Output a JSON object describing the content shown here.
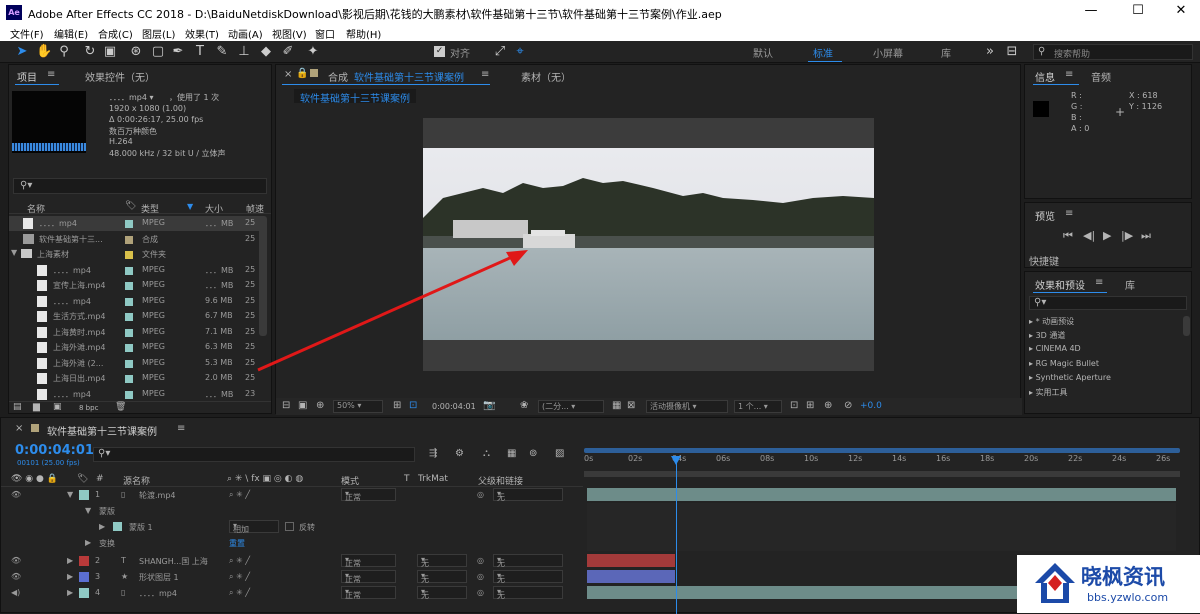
{
  "window": {
    "title": "Adobe After Effects CC 2018 - D:\\BaiduNetdiskDownload\\影视后期\\花钱的大鹏素材\\软件基础第十三节\\软件基础第十三节案例\\作业.aep",
    "logo": "Ae",
    "minimize": "—",
    "maximize": "☐",
    "close": "✕"
  },
  "menu": [
    "文件(F)",
    "编辑(E)",
    "合成(C)",
    "图层(L)",
    "效果(T)",
    "动画(A)",
    "视图(V)",
    "窗口",
    "帮助(H)"
  ],
  "toolbar": {
    "align_label": "对齐",
    "workspaces": [
      "默认",
      "标准",
      "小屏幕",
      "库"
    ],
    "active_workspace": "标准",
    "search_placeholder": "搜索帮助"
  },
  "project": {
    "tab_project": "项目",
    "tab_effects": "效果控件（无）",
    "selected_name": "．．．．mp4 ▾",
    "used": "，使用了 1 次",
    "info": [
      "1920 x 1080 (1.00)",
      "Δ 0:00:26:17, 25.00 fps",
      "数百万种颜色",
      "H.264",
      "48.000 kHz / 32 bit U / 立体声"
    ],
    "columns": {
      "name": "名称",
      "type": "类型",
      "size": "大小",
      "rate": "帧速"
    },
    "items": [
      {
        "name": "．．．．mp4",
        "type": "MPEG",
        "size": "．．．MB",
        "rate": "25",
        "color": "#8fc9c4",
        "icon": "file"
      },
      {
        "name": "软件基础第十三...",
        "type": "合成",
        "size": "",
        "rate": "25",
        "color": "#b0a27a",
        "icon": "comp"
      },
      {
        "name": "上海素材",
        "type": "文件夹",
        "size": "",
        "rate": "",
        "color": "#d9c04a",
        "icon": "folder"
      },
      {
        "name": "．．．．mp4",
        "type": "MPEG",
        "size": "．．．MB",
        "rate": "25",
        "color": "#8fc9c4",
        "icon": "file"
      },
      {
        "name": "宣传上海.mp4",
        "type": "MPEG",
        "size": "．．．MB",
        "rate": "25",
        "color": "#8fc9c4",
        "icon": "file"
      },
      {
        "name": "．．．．mp4",
        "type": "MPEG",
        "size": "9.6 MB",
        "rate": "25",
        "color": "#8fc9c4",
        "icon": "file"
      },
      {
        "name": "生活方式.mp4",
        "type": "MPEG",
        "size": "6.7 MB",
        "rate": "25",
        "color": "#8fc9c4",
        "icon": "file"
      },
      {
        "name": "上海黄时.mp4",
        "type": "MPEG",
        "size": "7.1 MB",
        "rate": "25",
        "color": "#8fc9c4",
        "icon": "file"
      },
      {
        "name": "上海外滩.mp4",
        "type": "MPEG",
        "size": "6.3 MB",
        "rate": "25",
        "color": "#8fc9c4",
        "icon": "file"
      },
      {
        "name": "上海外滩 (2...",
        "type": "MPEG",
        "size": "5.3 MB",
        "rate": "25",
        "color": "#8fc9c4",
        "icon": "file"
      },
      {
        "name": "上海日出.mp4",
        "type": "MPEG",
        "size": "2.0 MB",
        "rate": "25",
        "color": "#8fc9c4",
        "icon": "file"
      },
      {
        "name": "．．．．mp4",
        "type": "MPEG",
        "size": "．．．MB",
        "rate": "23",
        "color": "#8fc9c4",
        "icon": "file"
      }
    ],
    "bpc": "8 bpc"
  },
  "comp": {
    "tab_label": "合成",
    "comp_name": "软件基础第十三节课案例",
    "menu_icon": "≡",
    "footage_tab": "素材（无）",
    "breadcrumb": "软件基础第十三节课案例",
    "zoom": "50%",
    "timecode": "0:00:04:01",
    "resolution": "(二分...",
    "camera": "活动摄像机",
    "views": "1 个...",
    "exposure": "+0.0"
  },
  "info_panel": {
    "tab": "信息",
    "tab2": "音频",
    "r": "R :",
    "g": "G :",
    "b": "B :",
    "a": "A : 0",
    "x": "X : 618",
    "y": "Y : 1126"
  },
  "preview": {
    "tab": "预览",
    "shortcut": "快捷键"
  },
  "effects": {
    "tab": "效果和预设",
    "tab2": "库",
    "items": [
      "* 动画预设",
      "3D 通道",
      "CINEMA 4D",
      "RG Magic Bullet",
      "Synthetic Aperture",
      "实用工具"
    ]
  },
  "timeline": {
    "comp_name": "软件基础第十三节课案例",
    "timecode": "0:00:04:01",
    "timecode_sub": "00101 (25.00 fps)",
    "col_source": "源名称",
    "col_mode": "模式",
    "col_t": "T",
    "col_trkmat": "TrkMat",
    "col_parent": "父级和链接",
    "ruler": [
      "0s",
      "02s",
      "04s",
      "06s",
      "08s",
      "10s",
      "12s",
      "14s",
      "16s",
      "18s",
      "20s",
      "22s",
      "24s",
      "26s"
    ],
    "current_time_frac": 0.154,
    "layers": [
      {
        "num": "1",
        "name": "轮渡.mp4",
        "mode": "正常",
        "parent": "无",
        "label_color": "#8fc9c4"
      },
      {
        "num": "2",
        "name": "SHANGH...国 上海",
        "mode": "正常",
        "trkmat": "无",
        "parent": "无",
        "label_color": "#b83a3a"
      },
      {
        "num": "3",
        "name": "形状图层 1",
        "mode": "正常",
        "trkmat": "无",
        "parent": "无",
        "label_color": "#5b6fd1"
      },
      {
        "num": "4",
        "name": "．．．．mp4",
        "mode": "正常",
        "trkmat": "无",
        "parent": "无",
        "label_color": "#8fc9c4"
      }
    ],
    "sub_masks": "蒙版",
    "sub_mask1": "蒙版 1",
    "mask_mode": "相加",
    "mask_invert": "反转",
    "sub_transform": "变换",
    "reset": "重置"
  },
  "watermark": {
    "title": "晓枫资讯",
    "url": "bbs.yzwlo.com"
  }
}
